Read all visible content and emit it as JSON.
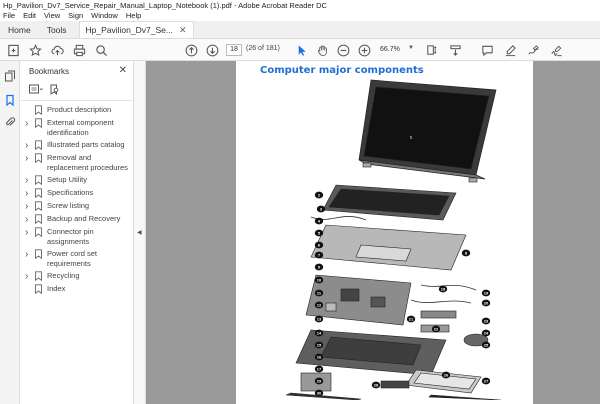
{
  "window": {
    "title": "Hp_Pavilion_Dv7_Service_Repair_Manual_Laptop_Notebook (1).pdf - Adobe Acrobat Reader DC"
  },
  "menu": [
    "File",
    "Edit",
    "View",
    "Sign",
    "Window",
    "Help"
  ],
  "tabs": {
    "home": "Home",
    "tools": "Tools",
    "doc": "Hp_Pavilion_Dv7_Se..."
  },
  "toolbar": {
    "page_number": "18",
    "page_count": "(26 of 181)",
    "zoom": "66.7%"
  },
  "bookmarks": {
    "title": "Bookmarks",
    "items": [
      {
        "label": "Product description",
        "expandable": false
      },
      {
        "label": "External component identification",
        "expandable": true
      },
      {
        "label": "Illustrated parts catalog",
        "expandable": true
      },
      {
        "label": "Removal and replacement procedures",
        "expandable": true
      },
      {
        "label": "Setup Utility",
        "expandable": true
      },
      {
        "label": "Specifications",
        "expandable": true
      },
      {
        "label": "Screw listing",
        "expandable": true
      },
      {
        "label": "Backup and Recovery",
        "expandable": true
      },
      {
        "label": "Connector pin assignments",
        "expandable": true
      },
      {
        "label": "Power cord set requirements",
        "expandable": true
      },
      {
        "label": "Recycling",
        "expandable": true
      },
      {
        "label": "Index",
        "expandable": false
      }
    ]
  },
  "document": {
    "heading": "Computer major components",
    "callouts": [
      "1",
      "2",
      "3",
      "4",
      "5",
      "6",
      "7",
      "8",
      "9",
      "10",
      "11",
      "12",
      "13",
      "14",
      "15",
      "16",
      "17",
      "18",
      "19",
      "20",
      "21",
      "22",
      "23",
      "24",
      "25",
      "26",
      "27",
      "28",
      "29",
      "30"
    ]
  },
  "colors": {
    "heading": "#1f6fd1",
    "accent": "#1473e6",
    "viewer_bg": "#9a9a9a"
  }
}
